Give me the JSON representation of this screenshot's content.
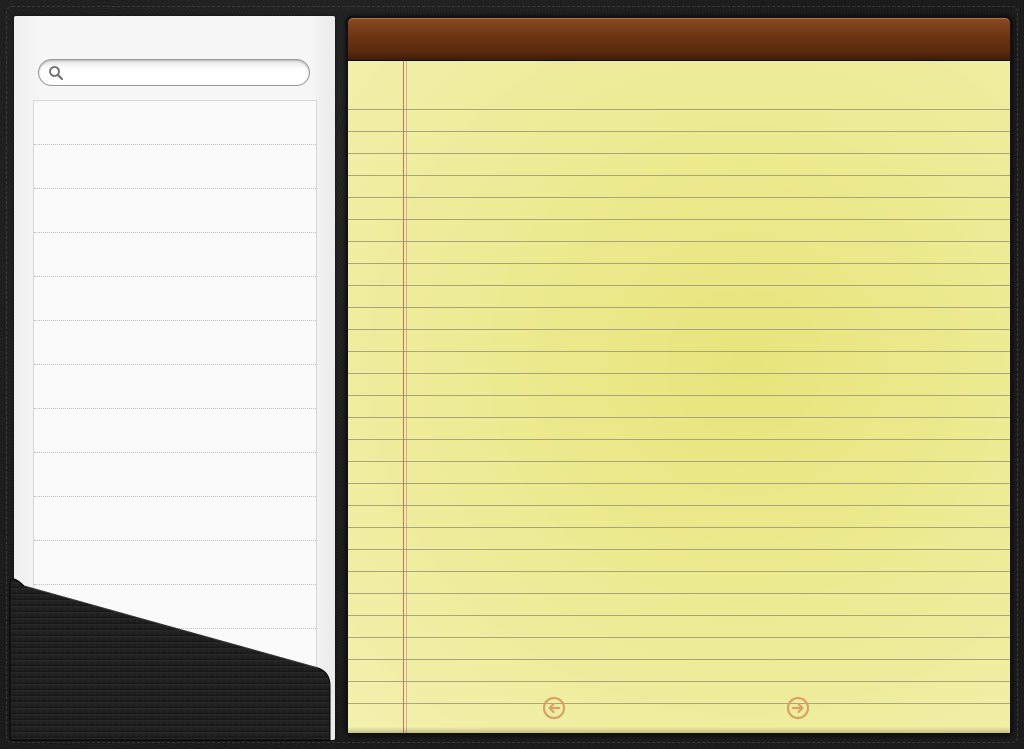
{
  "sidebar": {
    "search": {
      "placeholder": "",
      "value": "",
      "icon": "search-icon"
    },
    "notes": []
  },
  "pad": {
    "note_text": "",
    "prev_icon": "arrow-left-circle-icon",
    "next_icon": "arrow-right-circle-icon"
  },
  "colors": {
    "paper": "#ecea91",
    "binding": "#6d3414",
    "margin_line": "#c9726b",
    "nav_icon": "#d7a168",
    "leather": "#1b1b1b"
  }
}
